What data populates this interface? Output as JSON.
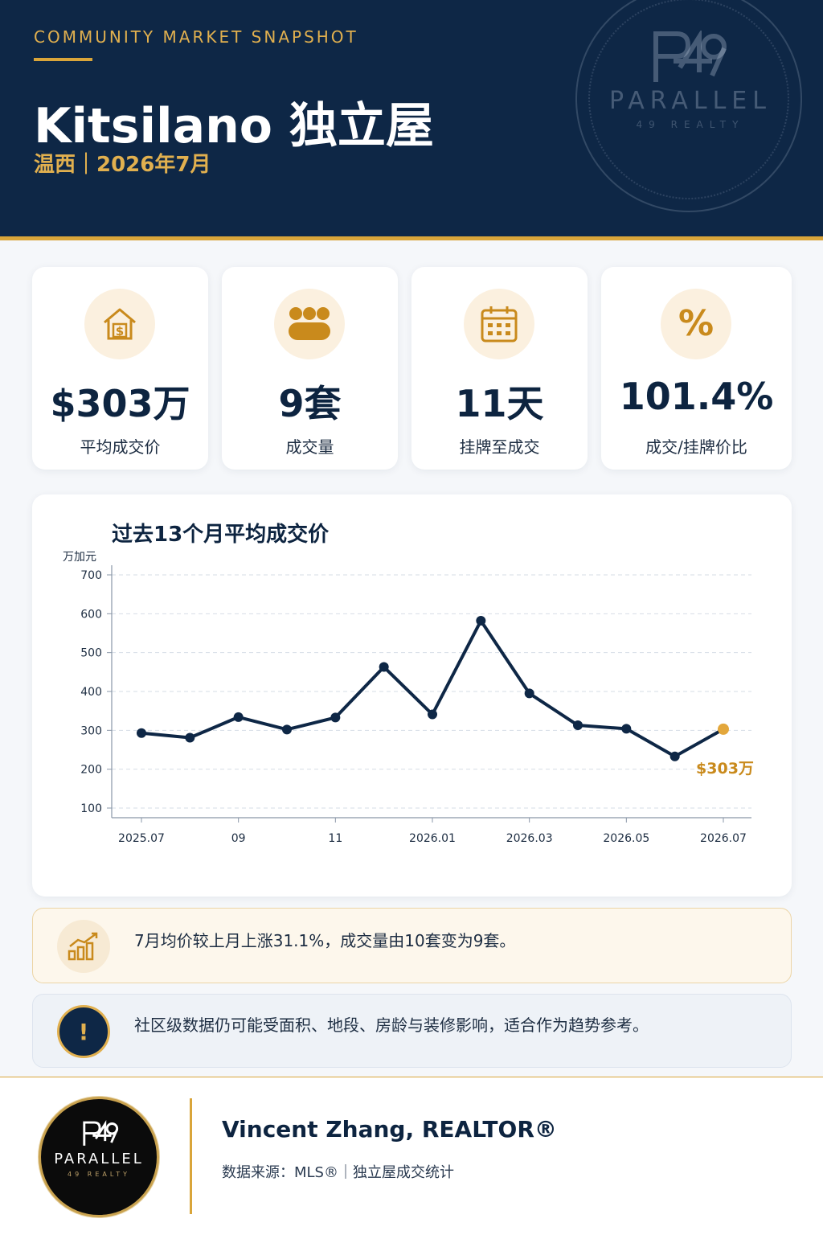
{
  "header": {
    "eyebrow": "COMMUNITY MARKET SNAPSHOT",
    "title": "Kitsilano 独立屋",
    "subtitle": "温西｜2026年7月",
    "watermark_brand": "PARALLEL",
    "watermark_sub": "49 REALTY"
  },
  "kpis": [
    {
      "icon": "house-dollar-icon",
      "value": "$303万",
      "label": "平均成交价"
    },
    {
      "icon": "coins-icon",
      "value": "9套",
      "label": "成交量"
    },
    {
      "icon": "calendar-icon",
      "value": "11天",
      "label": "挂牌至成交"
    },
    {
      "icon": "percent-icon",
      "value": "101.4%",
      "label": "成交/挂牌价比",
      "glyph": "%"
    }
  ],
  "chart_data": {
    "type": "line",
    "title": "过去13个月平均成交价",
    "ylabel": "万加元",
    "xlabel": "",
    "ylim": [
      100,
      700
    ],
    "yticks": [
      100,
      200,
      300,
      400,
      500,
      600,
      700
    ],
    "x": [
      "2025.07",
      "2025.08",
      "2025.09",
      "2025.10",
      "2025.11",
      "2025.12",
      "2026.01",
      "2026.02",
      "2026.03",
      "2026.04",
      "2026.05",
      "2026.06",
      "2026.07"
    ],
    "xtick_labels": [
      "2025.07",
      "",
      "09",
      "",
      "11",
      "",
      "2026.01",
      "",
      "2026.03",
      "",
      "2026.05",
      "",
      "2026.07"
    ],
    "values": [
      293,
      281,
      334,
      302,
      333,
      463,
      341,
      582,
      395,
      313,
      304,
      233,
      303
    ],
    "last_point_label": "$303万",
    "grid": true,
    "line_color": "#0e2746",
    "highlight_color": "#e3a73c"
  },
  "notes": [
    {
      "icon": "bar-chart-trend-icon",
      "text": "7月均价较上月上涨31.1%，成交量由10套变为9套。"
    },
    {
      "icon": "exclamation-icon",
      "glyph": "!",
      "text": "社区级数据仍可能受面积、地段、房龄与装修影响，适合作为趋势参考。"
    }
  ],
  "footer": {
    "logo_brand": "PARALLEL",
    "logo_sub": "49 REALTY",
    "agent": "Vincent Zhang, REALTOR®",
    "source": "数据来源：MLS®｜独立屋成交统计"
  },
  "colors": {
    "navy": "#0e2746",
    "gold": "#d9a53a",
    "gold_text": "#c98a1c"
  }
}
